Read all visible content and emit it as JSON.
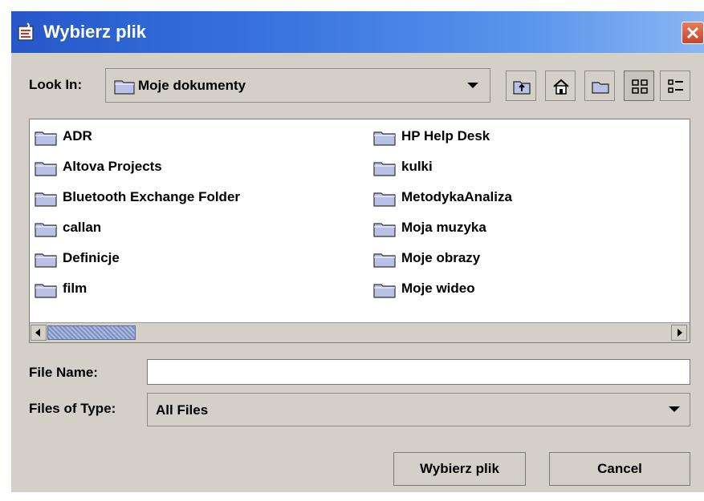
{
  "window": {
    "title": "Wybierz plik",
    "title_icon": "java-cup-icon",
    "close_icon": "close-icon"
  },
  "toolbar": {
    "look_in_label": "Look In:",
    "look_in_value": "Moje dokumenty",
    "buttons": [
      {
        "icon": "up-one-level-icon"
      },
      {
        "icon": "home-icon"
      },
      {
        "icon": "new-folder-icon"
      },
      {
        "icon": "list-view-icon",
        "active": true
      },
      {
        "icon": "details-view-icon"
      }
    ]
  },
  "files": {
    "left": [
      "ADR",
      "Altova Projects",
      "Bluetooth Exchange Folder",
      "callan",
      "Definicje",
      "film"
    ],
    "right": [
      "HP Help Desk",
      "kulki",
      "MetodykaAnaliza",
      "Moja muzyka",
      "Moje obrazy",
      "Moje wideo"
    ]
  },
  "form": {
    "file_name_label": "File Name:",
    "file_name_value": "",
    "files_of_type_label": "Files of Type:",
    "files_of_type_value": "All Files"
  },
  "actions": {
    "approve_label": "Wybierz plik",
    "cancel_label": "Cancel"
  },
  "colors": {
    "titlebar": "#2657c9",
    "panel": "#d4d0c8",
    "folder": "#b9c2e6"
  }
}
